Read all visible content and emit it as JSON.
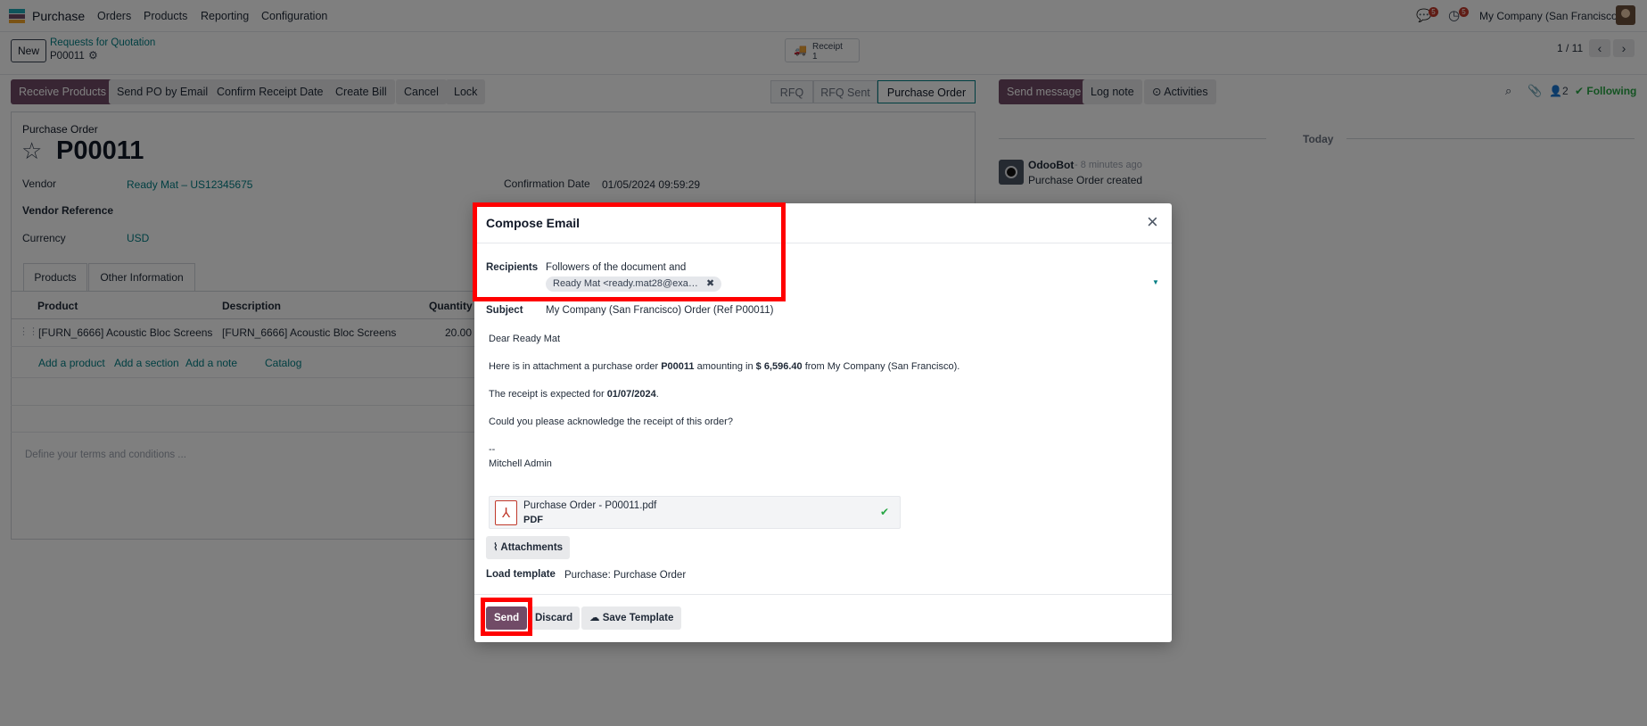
{
  "navbar": {
    "app": "Purchase",
    "menus": [
      "Orders",
      "Products",
      "Reporting",
      "Configuration"
    ],
    "chat_count": "5",
    "activity_count": "5",
    "company": "My Company (San Francisco)"
  },
  "controlpanel": {
    "new_label": "New",
    "breadcrumb": "Requests for Quotation",
    "record": "P00011",
    "receipt_label": "Receipt",
    "receipt_count": "1",
    "pager": "1 / 11"
  },
  "actions": {
    "receive": "Receive Products",
    "send_po": "Send PO by Email",
    "confirm_receipt": "Confirm Receipt Date",
    "create_bill": "Create Bill",
    "cancel": "Cancel",
    "lock": "Lock"
  },
  "stages": [
    "RFQ",
    "RFQ Sent",
    "Purchase Order"
  ],
  "form": {
    "type_label": "Purchase Order",
    "name": "P00011",
    "vendor_label": "Vendor",
    "vendor_value": "Ready Mat – US12345675",
    "vendor_ref_label": "Vendor Reference",
    "currency_label": "Currency",
    "currency_value": "USD",
    "confirmation_label": "Confirmation Date",
    "confirmation_value": "01/05/2024 09:59:29",
    "tabs": [
      "Products",
      "Other Information"
    ],
    "columns": [
      "Product",
      "Description",
      "Quantity"
    ],
    "line": {
      "product": "[FURN_6666] Acoustic Bloc Screens",
      "description": "[FURN_6666] Acoustic Bloc Screens",
      "quantity": "20.00"
    },
    "add_product": "Add a product",
    "add_section": "Add a section",
    "add_note": "Add a note",
    "catalog": "Catalog",
    "terms_placeholder": "Define your terms and conditions ..."
  },
  "chatter": {
    "send_message": "Send message",
    "log_note": "Log note",
    "activities": "Activities",
    "followers": "2",
    "following": "Following",
    "today": "Today",
    "author": "OdooBot",
    "time": "- 8 minutes ago",
    "message": "Purchase Order created"
  },
  "dialog": {
    "title": "Compose Email",
    "recipients_label": "Recipients",
    "recipients_text": "Followers of the document and",
    "recipient_tag": "Ready Mat <ready.mat28@exa…",
    "subject_label": "Subject",
    "subject_value": "My Company (San Francisco) Order (Ref P00011)",
    "body": {
      "greeting": "Dear Ready Mat",
      "l2_a": "Here is in attachment a purchase order ",
      "l2_b": "P00011",
      "l2_c": " amounting in ",
      "l2_d": "$ 6,596.40",
      "l2_e": " from My Company (San Francisco).",
      "l3_a": "The receipt is expected for ",
      "l3_b": "01/07/2024",
      "l3_c": ".",
      "l4": "Could you please acknowledge the receipt of this order?",
      "sig_sep": "--",
      "signature": "Mitchell Admin"
    },
    "attachment_name": "Purchase Order - P00011.pdf",
    "attachment_type": "PDF",
    "attachments_btn": "Attachments",
    "template_label": "Load template",
    "template_value": "Purchase: Purchase Order",
    "send": "Send",
    "discard": "Discard",
    "save_template": "Save Template"
  }
}
